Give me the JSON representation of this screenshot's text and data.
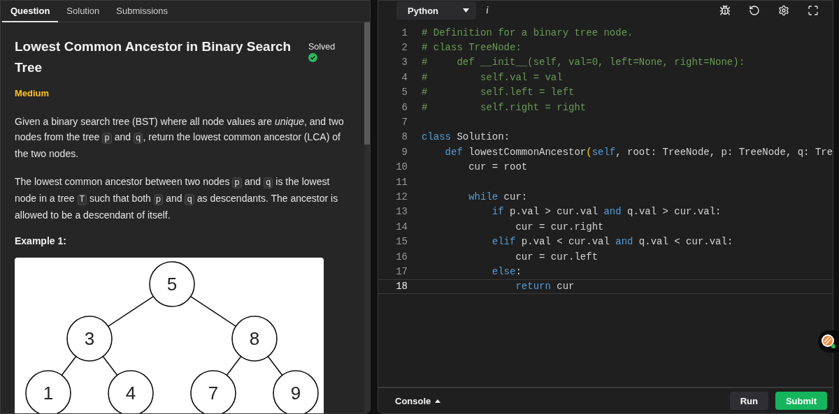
{
  "tabs": [
    {
      "label": "Question",
      "selected": true
    },
    {
      "label": "Solution",
      "selected": false
    },
    {
      "label": "Submissions",
      "selected": false
    }
  ],
  "problem": {
    "title": "Lowest Common Ancestor in Binary Search Tree",
    "status": {
      "label": "Solved",
      "solved": true
    },
    "difficulty": "Medium",
    "paragraphs": [
      [
        {
          "kind": "text",
          "text": "Given a binary search tree (BST) where all node values are "
        },
        {
          "kind": "italic",
          "text": "unique"
        },
        {
          "kind": "text",
          "text": ", and two nodes from the tree "
        },
        {
          "kind": "code",
          "text": "p"
        },
        {
          "kind": "text",
          "text": " and "
        },
        {
          "kind": "code",
          "text": "q"
        },
        {
          "kind": "text",
          "text": ", return the lowest common ancestor (LCA) of the two nodes."
        }
      ],
      [
        {
          "kind": "text",
          "text": "The lowest common ancestor between two nodes "
        },
        {
          "kind": "code",
          "text": "p"
        },
        {
          "kind": "text",
          "text": " and "
        },
        {
          "kind": "code",
          "text": "q"
        },
        {
          "kind": "text",
          "text": " is the lowest node in a tree "
        },
        {
          "kind": "code",
          "text": "T"
        },
        {
          "kind": "text",
          "text": " such that both "
        },
        {
          "kind": "code",
          "text": "p"
        },
        {
          "kind": "text",
          "text": " and "
        },
        {
          "kind": "code",
          "text": "q"
        },
        {
          "kind": "text",
          "text": " as descendants. The ancestor is allowed to be a descendant of itself."
        }
      ]
    ],
    "example_heading": "Example 1:",
    "example_tree": {
      "value": "5",
      "children": [
        {
          "value": "3",
          "children": [
            {
              "value": "1"
            },
            {
              "value": "4"
            }
          ]
        },
        {
          "value": "8",
          "children": [
            {
              "value": "7"
            },
            {
              "value": "9"
            }
          ]
        }
      ]
    }
  },
  "editor": {
    "language": "Python",
    "info_label": "i",
    "lines": [
      {
        "number": "1",
        "current": false,
        "tokens": [
          {
            "kind": "comment",
            "text": "# Definition for a binary tree node."
          }
        ]
      },
      {
        "number": "2",
        "current": false,
        "tokens": [
          {
            "kind": "comment",
            "text": "# class TreeNode:"
          }
        ]
      },
      {
        "number": "3",
        "current": false,
        "tokens": [
          {
            "kind": "comment",
            "text": "#     def __init__(self, val=0, left=None, right=None):"
          }
        ]
      },
      {
        "number": "4",
        "current": false,
        "tokens": [
          {
            "kind": "comment",
            "text": "#         self.val = val"
          }
        ]
      },
      {
        "number": "5",
        "current": false,
        "tokens": [
          {
            "kind": "comment",
            "text": "#         self.left = left"
          }
        ]
      },
      {
        "number": "6",
        "current": false,
        "tokens": [
          {
            "kind": "comment",
            "text": "#         self.right = right"
          }
        ]
      },
      {
        "number": "7",
        "current": false
      },
      {
        "number": "8",
        "current": false,
        "tokens": [
          {
            "kind": "keyword",
            "text": "class"
          },
          {
            "kind": "plain",
            "text": " Solution:"
          }
        ]
      },
      {
        "number": "9",
        "current": false,
        "tokens": [
          {
            "kind": "keyword",
            "text": "    def"
          },
          {
            "kind": "plain",
            "text": " lowestCommonAncestor"
          },
          {
            "kind": "bracket",
            "text": "("
          },
          {
            "kind": "keyword",
            "text": "self"
          },
          {
            "kind": "plain",
            "text": ", root: TreeNode, p: TreeNode, q: Tre"
          }
        ]
      },
      {
        "number": "10",
        "current": false,
        "tokens": [
          {
            "kind": "plain",
            "text": "        cur = root"
          }
        ]
      },
      {
        "number": "11",
        "current": false
      },
      {
        "number": "12",
        "current": false,
        "tokens": [
          {
            "kind": "keyword",
            "text": "        while"
          },
          {
            "kind": "plain",
            "text": " cur:"
          }
        ]
      },
      {
        "number": "13",
        "current": false,
        "tokens": [
          {
            "kind": "keyword",
            "text": "            if"
          },
          {
            "kind": "plain",
            "text": " p.val > cur.val "
          },
          {
            "kind": "keyword",
            "text": "and"
          },
          {
            "kind": "plain",
            "text": " q.val > cur.val:"
          }
        ]
      },
      {
        "number": "14",
        "current": false,
        "tokens": [
          {
            "kind": "plain",
            "text": "                cur = cur.right"
          }
        ]
      },
      {
        "number": "15",
        "current": false,
        "tokens": [
          {
            "kind": "keyword",
            "text": "            elif"
          },
          {
            "kind": "plain",
            "text": " p.val < cur.val "
          },
          {
            "kind": "keyword",
            "text": "and"
          },
          {
            "kind": "plain",
            "text": " q.val < cur.val:"
          }
        ]
      },
      {
        "number": "16",
        "current": false,
        "tokens": [
          {
            "kind": "plain",
            "text": "                cur = cur.left"
          }
        ]
      },
      {
        "number": "17",
        "current": false,
        "tokens": [
          {
            "kind": "keyword",
            "text": "            else"
          },
          {
            "kind": "plain",
            "text": ":"
          }
        ]
      },
      {
        "number": "18",
        "current": true,
        "tokens": [
          {
            "kind": "keyword",
            "text": "                return"
          },
          {
            "kind": "plain",
            "text": " cur"
          }
        ]
      }
    ]
  },
  "footer": {
    "console": "Console",
    "buttons": [
      {
        "label": "Run",
        "kind": "secondary"
      },
      {
        "label": "Submit",
        "kind": "primary"
      }
    ]
  }
}
